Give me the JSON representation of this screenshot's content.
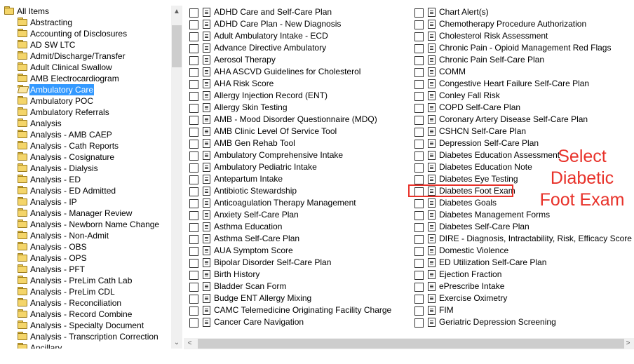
{
  "tree": {
    "items": [
      {
        "label": "All Items",
        "icon": "folder-icon"
      },
      {
        "label": "Abstracting",
        "icon": "folder-icon"
      },
      {
        "label": "Accounting of Disclosures",
        "icon": "folder-icon"
      },
      {
        "label": "AD SW LTC",
        "icon": "folder-icon"
      },
      {
        "label": "Admit/Discharge/Transfer",
        "icon": "folder-icon"
      },
      {
        "label": "Adult Clinical Swallow",
        "icon": "folder-icon"
      },
      {
        "label": "AMB Electrocardiogram",
        "icon": "folder-icon"
      },
      {
        "label": "Ambulatory Care",
        "icon": "open-folder-icon",
        "selected": true
      },
      {
        "label": "Ambulatory POC",
        "icon": "folder-icon"
      },
      {
        "label": "Ambulatory Referrals",
        "icon": "folder-icon"
      },
      {
        "label": "Analysis",
        "icon": "folder-icon"
      },
      {
        "label": "Analysis - AMB CAEP",
        "icon": "folder-icon"
      },
      {
        "label": "Analysis - Cath Reports",
        "icon": "folder-icon"
      },
      {
        "label": "Analysis - Cosignature",
        "icon": "folder-icon"
      },
      {
        "label": "Analysis - Dialysis",
        "icon": "folder-icon"
      },
      {
        "label": "Analysis - ED",
        "icon": "folder-icon"
      },
      {
        "label": "Analysis - ED Admitted",
        "icon": "folder-icon"
      },
      {
        "label": "Analysis - IP",
        "icon": "folder-icon"
      },
      {
        "label": "Analysis - Manager Review",
        "icon": "folder-icon"
      },
      {
        "label": "Analysis - Newborn Name Change",
        "icon": "folder-icon"
      },
      {
        "label": "Analysis - Non-Admit",
        "icon": "folder-icon"
      },
      {
        "label": "Analysis - OBS",
        "icon": "folder-icon"
      },
      {
        "label": "Analysis - OPS",
        "icon": "folder-icon"
      },
      {
        "label": "Analysis - PFT",
        "icon": "folder-icon"
      },
      {
        "label": "Analysis - PreLim Cath Lab",
        "icon": "folder-icon"
      },
      {
        "label": "Analysis - PreLim CDL",
        "icon": "folder-icon"
      },
      {
        "label": "Analysis - Reconciliation",
        "icon": "folder-icon"
      },
      {
        "label": "Analysis - Record Combine",
        "icon": "folder-icon"
      },
      {
        "label": "Analysis - Specialty Document",
        "icon": "folder-icon"
      },
      {
        "label": "Analysis - Transcription Correction",
        "icon": "folder-icon"
      },
      {
        "label": "Ancillary",
        "icon": "folder-icon"
      }
    ]
  },
  "forms": {
    "column1": [
      "ADHD Care and Self-Care Plan",
      "ADHD Care Plan - New Diagnosis",
      "Adult Ambulatory Intake - ECD",
      "Advance Directive Ambulatory",
      "Aerosol Therapy",
      "AHA ASCVD Guidelines for Cholesterol",
      "AHA Risk Score",
      "Allergy Injection Record (ENT)",
      "Allergy Skin Testing",
      "AMB - Mood Disorder Questionnaire (MDQ)",
      "AMB Clinic Level Of Service Tool",
      "AMB Gen Rehab Tool",
      "Ambulatory Comprehensive Intake",
      "Ambulatory Pediatric Intake",
      "Antepartum Intake",
      "Antibiotic Stewardship",
      "Anticoagulation Therapy Management",
      "Anxiety Self-Care Plan",
      "Asthma Education",
      "Asthma Self-Care Plan",
      "AUA Symptom Score",
      "Bipolar Disorder Self-Care Plan",
      "Birth History",
      "Bladder Scan Form",
      "Budge ENT Allergy Mixing",
      "CAMC Telemedicine Originating Facility Charge",
      "Cancer Care Navigation"
    ],
    "column2": [
      "Chart Alert(s)",
      "Chemotherapy Procedure Authorization",
      "Cholesterol Risk Assessment",
      "Chronic Pain - Opioid Management Red Flags",
      "Chronic Pain Self-Care Plan",
      "COMM",
      "Congestive Heart Failure Self-Care Plan",
      "Conley Fall Risk",
      "COPD Self-Care Plan",
      "Coronary Artery Disease Self-Care Plan",
      "CSHCN Self-Care Plan",
      "Depression Self-Care Plan",
      "Diabetes Education Assessment",
      "Diabetes Education Note",
      "Diabetes Eye Testing",
      "Diabetes Foot Exam",
      "Diabetes Goals",
      "Diabetes Management Forms",
      "Diabetes Self-Care Plan",
      "DIRE - Diagnosis, Intractability, Risk, Efficacy Score",
      "Domestic Violence",
      "ED Utilization Self-Care Plan",
      "Ejection Fraction",
      "ePrescribe Intake",
      "Exercise Oximetry",
      "FIM",
      "Geriatric Depression Screening"
    ]
  },
  "annotation": {
    "lines": [
      "Select",
      "Diabetic",
      "Foot Exam"
    ],
    "color": "#e8322a"
  },
  "scroll": {
    "up": "▲",
    "down": "⌄",
    "left": "<",
    "right": ">"
  }
}
